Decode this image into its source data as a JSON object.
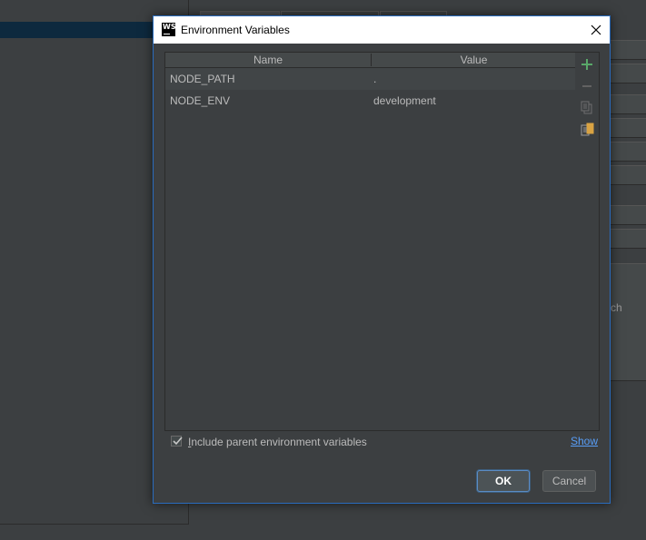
{
  "dialog": {
    "title": "Environment Variables",
    "app_icon_text": "WS"
  },
  "table": {
    "columns": [
      "Name",
      "Value"
    ],
    "rows": [
      {
        "name": "NODE_PATH",
        "value": "."
      },
      {
        "name": "NODE_ENV",
        "value": "development"
      }
    ]
  },
  "toolbar": {
    "icons": [
      "add-icon",
      "remove-icon",
      "copy-icon",
      "paste-icon"
    ]
  },
  "footer": {
    "checkbox_checked": true,
    "checkbox_label_mnemonic": "I",
    "checkbox_label_rest": "nclude parent environment variables",
    "show_link": "Show",
    "ok_label": "OK",
    "cancel_label": "Cancel"
  },
  "background": {
    "partial_text": "ch"
  },
  "colors": {
    "accent": "#2a6cbd",
    "add_green": "#59a869",
    "link": "#589df6"
  }
}
